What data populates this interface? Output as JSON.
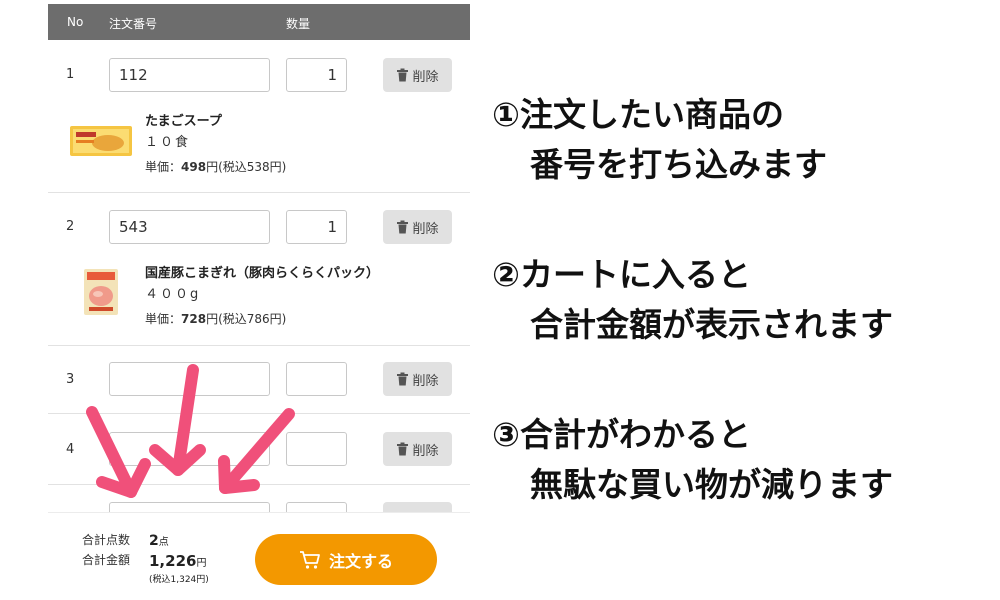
{
  "table": {
    "headers": {
      "no": "No",
      "order_no": "注文番号",
      "qty": "数量"
    },
    "delete_label": "削除",
    "rows": [
      {
        "no": "1",
        "order_no": "112",
        "qty": "1",
        "product": {
          "name": "たまごスープ",
          "amount": "１０食",
          "price_prefix": "単価：",
          "price": "498",
          "price_suffix": "円(税込538円)"
        }
      },
      {
        "no": "2",
        "order_no": "543",
        "qty": "1",
        "product": {
          "name": "国産豚こまぎれ（豚肉らくらくパック）",
          "amount": "４００g",
          "price_prefix": "単価：",
          "price": "728",
          "price_suffix": "円(税込786円)"
        }
      },
      {
        "no": "3",
        "order_no": "",
        "qty": ""
      },
      {
        "no": "4",
        "order_no": "",
        "qty": ""
      }
    ]
  },
  "footer": {
    "total_items_label": "合計点数",
    "total_items_value": "2",
    "total_items_unit": "点",
    "total_amount_label": "合計金額",
    "total_amount_value": "1,226",
    "total_amount_unit": "円",
    "total_amount_tax": "(税込1,324円)",
    "order_button": "注文する"
  },
  "annotations": [
    {
      "line1": "①注文したい商品の",
      "line2": "番号を打ち込みます"
    },
    {
      "line1": "②カートに入ると",
      "line2": "合計金額が表示されます"
    },
    {
      "line1": "③合計がわかると",
      "line2": "無駄な買い物が減ります"
    }
  ],
  "colors": {
    "header_bg": "#6d6d6d",
    "order_button": "#f39800",
    "arrow": "#f0507a"
  }
}
